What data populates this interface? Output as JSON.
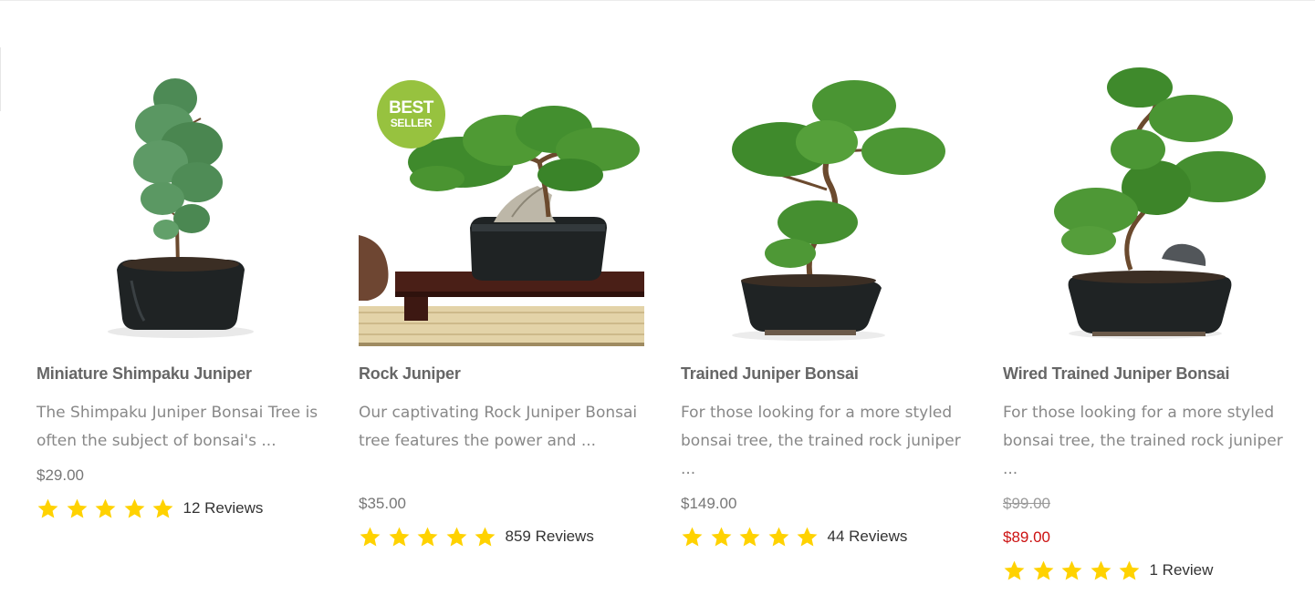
{
  "products": [
    {
      "title": "Miniature Shimpaku Juniper",
      "description": "The Shimpaku Juniper Bonsai Tree is often the subject of bonsai's ...",
      "price": "$29.00",
      "reviews": "12 Reviews",
      "rating": 5,
      "image_icon": "juniper-bonsai-photo"
    },
    {
      "title": "Rock Juniper",
      "description": "Our captivating Rock Juniper Bonsai tree features the power and ...",
      "price": "$35.00",
      "reviews": "859 Reviews",
      "rating": 5,
      "badge": {
        "line1": "BEST",
        "line2": "SELLER"
      },
      "image_icon": "juniper-bonsai-photo"
    },
    {
      "title": "Trained Juniper Bonsai",
      "description": "For those looking for a more styled bonsai tree, the trained rock juniper ...",
      "price": "$149.00",
      "reviews": "44 Reviews",
      "rating": 5,
      "image_icon": "juniper-bonsai-photo"
    },
    {
      "title": "Wired Trained Juniper Bonsai",
      "description": "For those looking for a more styled bonsai tree, the trained rock juniper ...",
      "original_price": "$99.00",
      "sale_price": "$89.00",
      "reviews": "1 Review",
      "rating": 5,
      "image_icon": "juniper-bonsai-photo"
    }
  ],
  "colors": {
    "star": "#ffd200",
    "badge": "#97c23f",
    "sale_price": "#cc1111",
    "title": "#666666",
    "description": "#888888",
    "pot": "#1f2324",
    "foliage": "#3f8a2c"
  }
}
